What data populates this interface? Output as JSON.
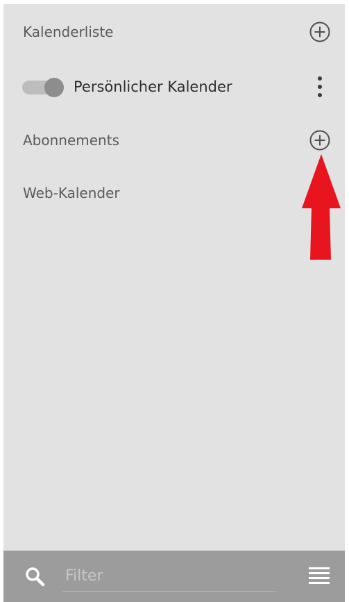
{
  "sections": {
    "calendar_list": {
      "label": "Kalenderliste",
      "add_icon": "plus-circle-icon"
    },
    "subscriptions": {
      "label": "Abonnements",
      "add_icon": "plus-circle-icon"
    },
    "web_calendar": {
      "label": "Web-Kalender"
    }
  },
  "calendars": [
    {
      "name": "Persönlicher Kalender",
      "enabled": true,
      "menu_icon": "kebab-menu-icon"
    }
  ],
  "annotation": {
    "color": "#e8141e",
    "icon": "arrow-up-icon"
  },
  "filter": {
    "placeholder": "Filter",
    "value": "",
    "search_icon": "search-icon",
    "menu_icon": "hamburger-menu-icon"
  },
  "colors": {
    "panel_bg": "#e2e2e2",
    "filter_bar_bg": "#9c9c9c",
    "annotation": "#e8141e"
  }
}
